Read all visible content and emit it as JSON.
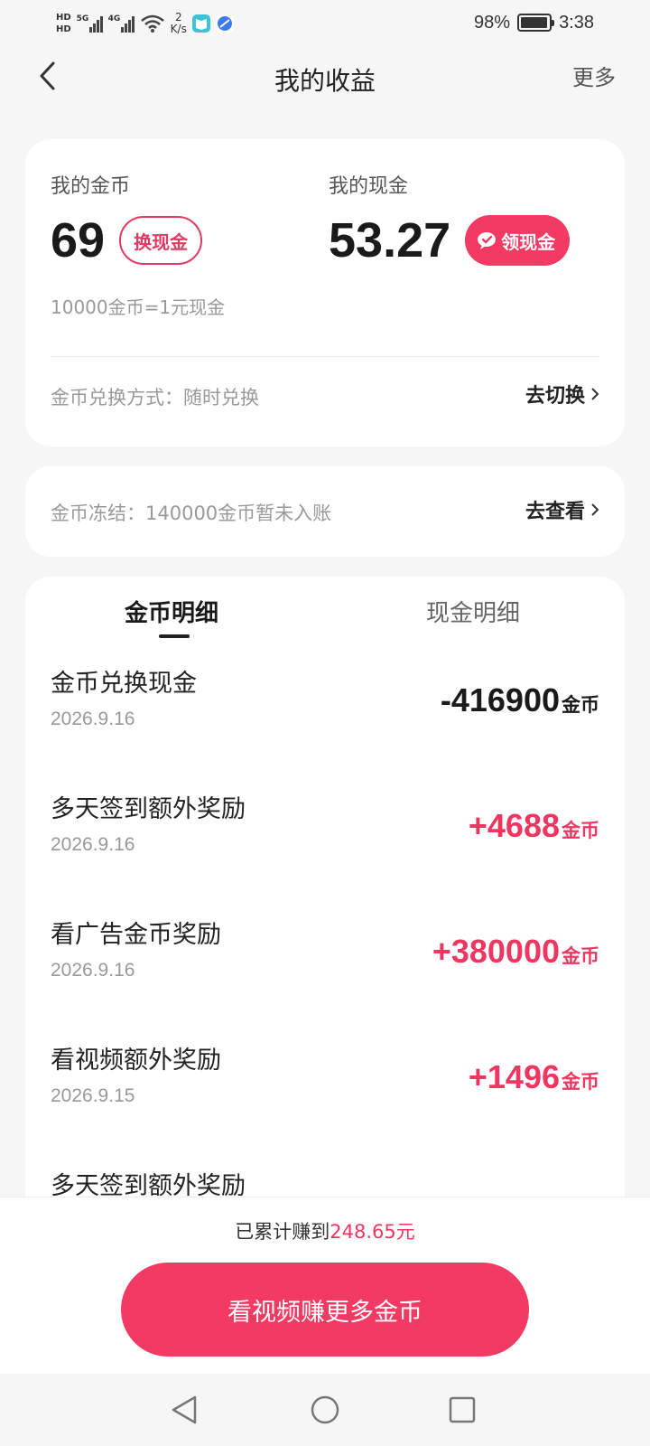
{
  "status_bar": {
    "hd_top": "HD",
    "hd_bottom": "HD",
    "net_1": "5G",
    "net_2": "4G",
    "speed_value": "2",
    "speed_unit": "K/s",
    "battery_percent": "98%",
    "battery_level": 0.98,
    "time": "3:38"
  },
  "header": {
    "title": "我的收益",
    "more_label": "更多"
  },
  "balance": {
    "coins_label": "我的金币",
    "coins_value": "69",
    "exchange_label": "换现金",
    "cash_label": "我的现金",
    "cash_value": "53.27",
    "withdraw_label": "领现金",
    "rate_text": "10000金币=1元现金",
    "method_text": "金币兑换方式：随时兑换",
    "method_link": "去切换"
  },
  "frozen": {
    "text": "金币冻结：140000金币暂未入账",
    "link": "去查看"
  },
  "tabs": [
    {
      "label": "金币明细",
      "active": true
    },
    {
      "label": "现金明细",
      "active": false
    }
  ],
  "records": [
    {
      "title": "金币兑换现金",
      "date": "2026.9.16",
      "amount": "-416900",
      "unit": "金币",
      "type": "neg"
    },
    {
      "title": "多天签到额外奖励",
      "date": "2026.9.16",
      "amount": "+4688",
      "unit": "金币",
      "type": "pos"
    },
    {
      "title": "看广告金币奖励",
      "date": "2026.9.16",
      "amount": "+380000",
      "unit": "金币",
      "type": "pos"
    },
    {
      "title": "看视频额外奖励",
      "date": "2026.9.15",
      "amount": "+1496",
      "unit": "金币",
      "type": "pos"
    },
    {
      "title": "多天签到额外奖励",
      "date": "",
      "amount": "",
      "unit": "",
      "type": "pos"
    }
  ],
  "footer": {
    "total_prefix": "已累计赚到",
    "total_value": "248.65元",
    "cta_label": "看视频赚更多金币"
  },
  "colors": {
    "accent": "#f23a63",
    "accent_text": "#ee3760",
    "background": "#f6f6f6"
  }
}
